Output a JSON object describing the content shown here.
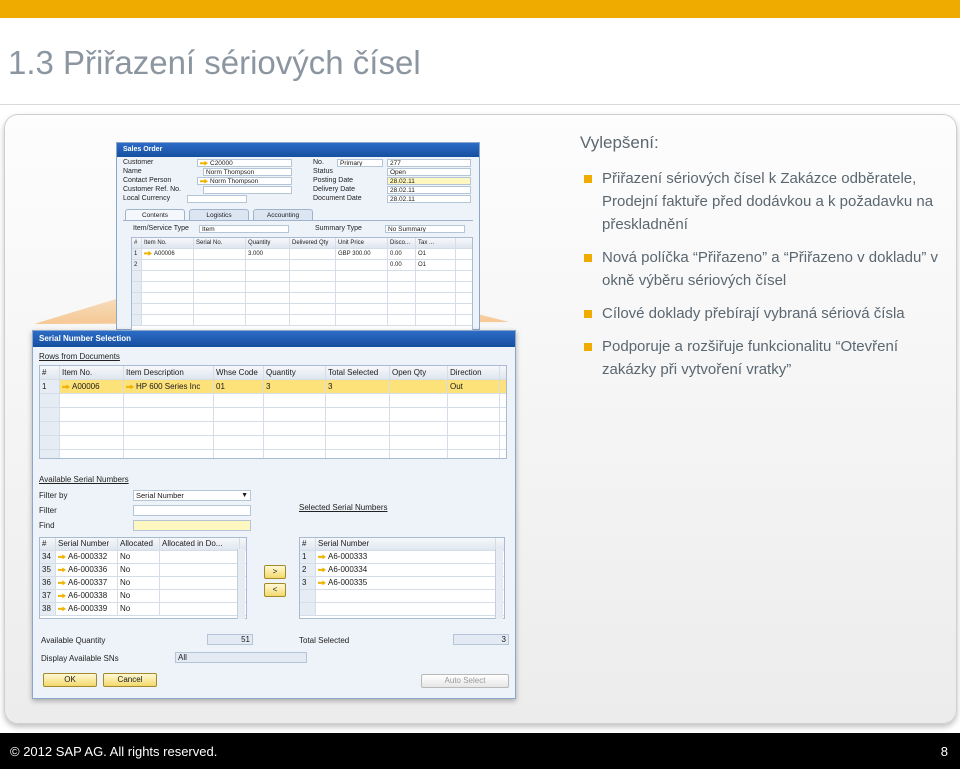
{
  "slide": {
    "title": "1.3 Přiřazení sériových čísel",
    "footer_copyright": "© 2012 SAP AG. All rights reserved.",
    "page_number": "8"
  },
  "bullets": {
    "heading": "Vylepšení:",
    "items": [
      "Přiřazení sériových čísel k Zakázce odběratele, Prodejní faktuře před dodávkou a k požadavku na přeskladnění",
      "Nová políčka “Přiřazeno” a “Přiřazeno v dokladu” v okně výběru sériových čísel",
      "Cílové doklady přebírají vybraná sériová čísla",
      "Podporuje a rozšiřuje funkcionalitu “Otevření zakázky při vytvoření vratky”"
    ]
  },
  "sales_order": {
    "title": "Sales Order",
    "left_labels": [
      "Customer",
      "Name",
      "Contact Person",
      "Customer Ref. No.",
      "Local Currency"
    ],
    "left_values": [
      "C20000",
      "Norm Thompson",
      "Norm Thompson",
      "",
      ""
    ],
    "right_labels": [
      "No.",
      "Status",
      "Posting Date",
      "Delivery Date",
      "Document Date"
    ],
    "right_values": [
      "277",
      "Open",
      "28.02.11",
      "28.02.11",
      "28.02.11"
    ],
    "no_series": "Primary",
    "tabs": [
      "Contents",
      "Logistics",
      "Accounting"
    ],
    "item_type_label": "Item/Service Type",
    "item_type_value": "Item",
    "summary_type_label": "Summary Type",
    "summary_type_value": "No Summary",
    "columns": [
      "#",
      "Item No.",
      "Serial No.",
      "Quantity",
      "Delivered Qty",
      "Unit Price",
      "Disco...",
      "Tax ..."
    ],
    "rows": [
      [
        "1",
        "A00006",
        "",
        "3.000",
        "",
        "GBP 300.00",
        "0.00",
        "O1"
      ],
      [
        "2",
        "",
        "",
        "",
        "",
        "",
        "0.00",
        "O1"
      ]
    ]
  },
  "serial_selection": {
    "title": "Serial Number Selection",
    "rows_from_documents": "Rows from Documents",
    "doc_columns": [
      "#",
      "Item No.",
      "Item Description",
      "Whse Code",
      "Quantity",
      "Total Selected",
      "Open Qty",
      "Direction"
    ],
    "doc_rows": [
      [
        "1",
        "A00006",
        "HP 600 Series Inc",
        "01",
        "3",
        "3",
        "",
        "Out"
      ]
    ],
    "available_title": "Available Serial Numbers",
    "filter_by_label": "Filter by",
    "filter_by_value": "Serial Number",
    "filter_label": "Filter",
    "find_label": "Find",
    "avail_columns": [
      "#",
      "Serial Number",
      "Allocated",
      "Allocated in Do..."
    ],
    "avail_rows": [
      [
        "34",
        "A6-000332",
        "No",
        ""
      ],
      [
        "35",
        "A6-000336",
        "No",
        ""
      ],
      [
        "36",
        "A6-000337",
        "No",
        ""
      ],
      [
        "37",
        "A6-000338",
        "No",
        ""
      ],
      [
        "38",
        "A6-000339",
        "No",
        ""
      ]
    ],
    "move_right": ">",
    "move_left": "<",
    "selected_title": "Selected Serial Numbers",
    "sel_columns": [
      "#",
      "Serial Number"
    ],
    "sel_rows": [
      [
        "1",
        "A6-000333"
      ],
      [
        "2",
        "A6-000334"
      ],
      [
        "3",
        "A6-000335"
      ]
    ],
    "available_qty_label": "Available Quantity",
    "available_qty_value": "51",
    "total_selected_label": "Total Selected",
    "total_selected_value": "3",
    "display_label": "Display Available SNs",
    "display_value": "All",
    "ok_label": "OK",
    "cancel_label": "Cancel",
    "auto_select_label": "Auto Select"
  },
  "colors": {
    "accent_gold": "#f0ab00",
    "title_gray": "#8c96a0",
    "text_gray": "#5b6770",
    "sap_blue": "#1d5fb5",
    "row_highlight": "#fde27a"
  }
}
